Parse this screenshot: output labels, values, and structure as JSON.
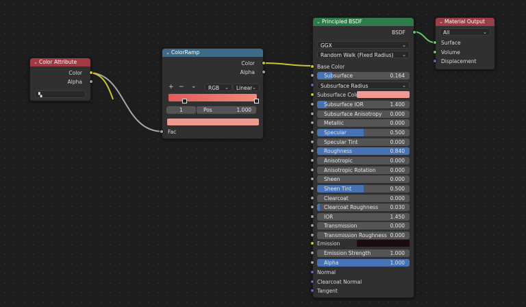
{
  "colors": {
    "accent": "#4772b3",
    "header_color_attribute": "#a23a44",
    "header_colorramp": "#3f6b88",
    "header_shader": "#2e7a48",
    "header_output": "#9c3e46",
    "ramp_gradient_start": "#e25a5a",
    "ramp_gradient_end": "#f08a7c",
    "ramp_output_swatch": "#ee9a8d",
    "subsurface_color": "#f19a94",
    "emission_color": "#1a0c0e"
  },
  "color_attribute": {
    "title": "Color Attribute",
    "outputs": [
      "Color",
      "Alpha"
    ],
    "attribute_icon": "vertex-color-icon"
  },
  "colorramp": {
    "title": "ColorRamp",
    "outputs": [
      "Color",
      "Alpha"
    ],
    "add_label": "+",
    "remove_label": "−",
    "menu_label": "⌄",
    "color_mode": "RGB",
    "interpolation": "Linear",
    "stop_index": "1",
    "pos_label": "Pos",
    "pos_value": "1.000",
    "input": "Fac"
  },
  "principled": {
    "title": "Principled BSDF",
    "output": "BSDF",
    "distribution": "GGX",
    "subsurface_method": "Random Walk (Fixed Radius)",
    "base_color_label": "Base Color",
    "subsurface": {
      "label": "Subsurface",
      "value": "0.164",
      "fill": 0.164
    },
    "subsurface_radius": "Subsurface Radius",
    "subsurface_color_label": "Subsurface Color",
    "params": [
      {
        "label": "Subsurface IOR",
        "value": "1.400",
        "fill": 0.1
      },
      {
        "label": "Subsurface Anisotropy",
        "value": "0.000",
        "fill": 0
      },
      {
        "label": "Metallic",
        "value": "0.000",
        "fill": 0
      },
      {
        "label": "Specular",
        "value": "0.500",
        "fill": 0.5
      },
      {
        "label": "Specular Tint",
        "value": "0.000",
        "fill": 0
      },
      {
        "label": "Roughness",
        "value": "0.840",
        "fill": 1.0
      },
      {
        "label": "Anisotropic",
        "value": "0.000",
        "fill": 0
      },
      {
        "label": "Anisotropic Rotation",
        "value": "0.000",
        "fill": 0
      },
      {
        "label": "Sheen",
        "value": "0.000",
        "fill": 0
      },
      {
        "label": "Sheen Tint",
        "value": "0.500",
        "fill": 0.5
      },
      {
        "label": "Clearcoat",
        "value": "0.000",
        "fill": 0
      },
      {
        "label": "Clearcoat Roughness",
        "value": "0.030",
        "fill": 0.03
      },
      {
        "label": "IOR",
        "value": "1.450",
        "fill": 0
      },
      {
        "label": "Transmission",
        "value": "0.000",
        "fill": 0
      },
      {
        "label": "Transmission Roughness",
        "value": "0.000",
        "fill": 0
      }
    ],
    "emission_label": "Emission",
    "emission_strength": {
      "label": "Emission Strength",
      "value": "1.000",
      "fill": 0
    },
    "alpha": {
      "label": "Alpha",
      "value": "1.000",
      "fill": 1.0
    },
    "vector_inputs": [
      "Normal",
      "Clearcoat Normal",
      "Tangent"
    ]
  },
  "material_output": {
    "title": "Material Output",
    "target": "All",
    "inputs": [
      "Surface",
      "Volume",
      "Displacement"
    ]
  }
}
